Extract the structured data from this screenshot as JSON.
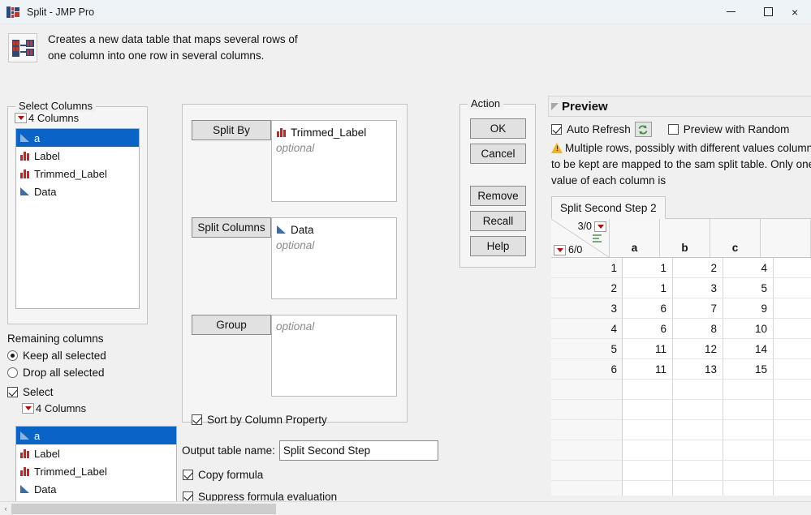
{
  "window": {
    "title": "Split - JMP Pro",
    "icon": "jmp-icon",
    "minimize_label": "—",
    "maximize_label": "□",
    "close_label": "×"
  },
  "header": {
    "icon": "split-table-icon",
    "description": "Creates a new data table that maps several rows of one column into one row in several columns."
  },
  "select_columns": {
    "group_title": "Select Columns",
    "count_label": "4 Columns",
    "items": [
      {
        "label": "a",
        "icon": "continuous-column-icon",
        "selected": true
      },
      {
        "label": "Label",
        "icon": "nominal-column-icon",
        "selected": false
      },
      {
        "label": "Trimmed_Label",
        "icon": "nominal-column-icon",
        "selected": false
      },
      {
        "label": "Data",
        "icon": "continuous-column-icon",
        "selected": false
      }
    ]
  },
  "remaining_columns": {
    "title": "Remaining columns",
    "keep_label": "Keep all selected",
    "keep_checked": true,
    "drop_label": "Drop all selected",
    "drop_checked": false,
    "select_label": "Select",
    "select_checked": true,
    "count_label": "4 Columns",
    "items": [
      {
        "label": "a",
        "icon": "continuous-column-icon",
        "selected": true
      },
      {
        "label": "Label",
        "icon": "nominal-column-icon",
        "selected": false
      },
      {
        "label": "Trimmed_Label",
        "icon": "nominal-column-icon",
        "selected": false
      },
      {
        "label": "Data",
        "icon": "continuous-column-icon",
        "selected": false
      }
    ]
  },
  "roles": {
    "split_by": {
      "button_label": "Split By",
      "assigned": "Trimmed_Label",
      "assigned_icon": "nominal-column-icon",
      "placeholder": "optional"
    },
    "split_columns": {
      "button_label": "Split Columns",
      "assigned": "Data",
      "assigned_icon": "continuous-column-icon",
      "placeholder": "optional"
    },
    "group": {
      "button_label": "Group",
      "assigned": "",
      "placeholder": "optional"
    },
    "sort_by_column_property": {
      "label": "Sort by Column Property",
      "checked": true
    }
  },
  "output": {
    "table_name_label": "Output table name:",
    "table_name_value": "Split Second Step",
    "copy_formula_label": "Copy formula",
    "copy_formula_checked": true,
    "suppress_formula_label": "Suppress formula evaluation",
    "suppress_formula_checked": true
  },
  "action": {
    "group_title": "Action",
    "buttons": [
      {
        "label": "OK"
      },
      {
        "label": "Cancel"
      },
      {
        "label": "Remove"
      },
      {
        "label": "Recall"
      },
      {
        "label": "Help"
      }
    ]
  },
  "preview": {
    "title": "Preview",
    "auto_refresh_label": "Auto Refresh",
    "auto_refresh_checked": true,
    "refresh_icon": "refresh-icon",
    "random_label": "Preview with Random",
    "random_checked": false,
    "warning_icon": "warning-icon",
    "warning_text": "Multiple rows, possibly with different values columns to be kept are mapped to the sam split table. Only one value of each column is",
    "tab_label": "Split Second Step 2",
    "table": {
      "col_count_label": "3/0",
      "row_count_label": "6/0",
      "columns": [
        "a",
        "b",
        "c"
      ],
      "rows": [
        {
          "n": "1",
          "values": [
            "1",
            "2",
            "4"
          ]
        },
        {
          "n": "2",
          "values": [
            "1",
            "3",
            "5"
          ]
        },
        {
          "n": "3",
          "values": [
            "6",
            "7",
            "9"
          ]
        },
        {
          "n": "4",
          "values": [
            "6",
            "8",
            "10"
          ]
        },
        {
          "n": "5",
          "values": [
            "11",
            "12",
            "14"
          ]
        },
        {
          "n": "6",
          "values": [
            "11",
            "13",
            "15"
          ]
        }
      ],
      "empty_rows": 7
    }
  },
  "scrollbar": {
    "left_arrow": "‹"
  },
  "colors": {
    "selection_blue": "#0a64c8",
    "nominal_red": "#cc2222",
    "continuous_blue": "#3b6ea5",
    "warning_yellow": "#f0b429",
    "dropdown_red": "#cc0000"
  }
}
